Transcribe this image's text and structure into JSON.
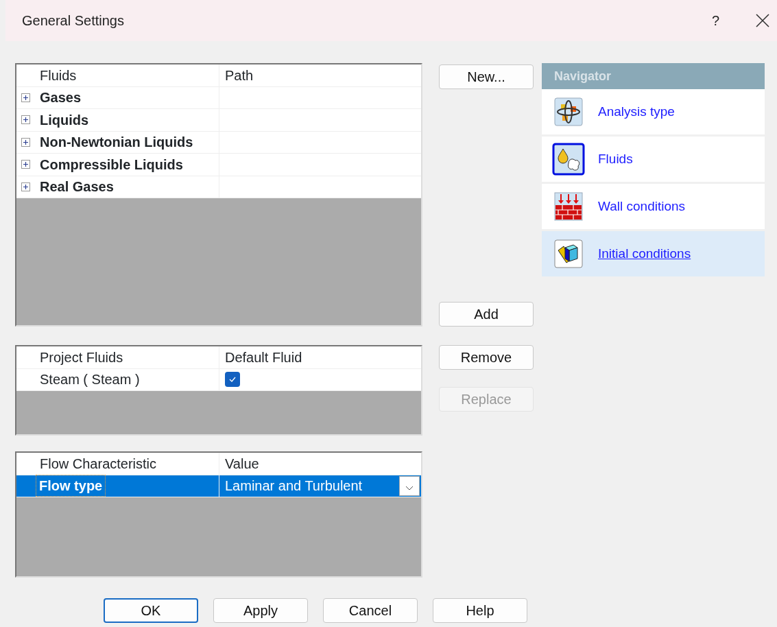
{
  "window": {
    "title": "General Settings",
    "help_button": "?"
  },
  "fluids_table": {
    "columns": [
      "Fluids",
      "Path"
    ],
    "rows": [
      {
        "label": "Gases",
        "expanded": false
      },
      {
        "label": "Liquids",
        "expanded": false
      },
      {
        "label": "Non-Newtonian Liquids",
        "expanded": false
      },
      {
        "label": "Compressible Liquids",
        "expanded": false
      },
      {
        "label": "Real Gases",
        "expanded": false
      }
    ]
  },
  "fluid_actions": [
    {
      "label": "New...",
      "disabled": false
    },
    {
      "label": "Add",
      "disabled": false
    }
  ],
  "project_fluids": {
    "columns": [
      "Project Fluids",
      "Default Fluid"
    ],
    "rows": [
      {
        "name": "Steam ( Steam )",
        "checked": true
      }
    ]
  },
  "project_actions": [
    {
      "label": "Remove",
      "disabled": false
    },
    {
      "label": "Replace",
      "disabled": true
    }
  ],
  "flow_table": {
    "columns": [
      "Flow Characteristic",
      "Value"
    ],
    "rows": [
      {
        "name": "Flow type",
        "value": "Laminar and Turbulent",
        "selected": true
      }
    ]
  },
  "navigator": {
    "title": "Navigator",
    "items": [
      {
        "label": "Analysis type",
        "kind": "analysis",
        "selected": false
      },
      {
        "label": "Fluids",
        "kind": "fluids",
        "selected": false
      },
      {
        "label": "Wall conditions",
        "kind": "wall",
        "selected": false
      },
      {
        "label": "Initial conditions",
        "kind": "initial",
        "selected": true
      }
    ]
  },
  "footer_buttons": [
    {
      "label": "OK",
      "default": true
    },
    {
      "label": "Apply",
      "default": false
    },
    {
      "label": "Cancel",
      "default": false
    },
    {
      "label": "Help",
      "default": false
    }
  ]
}
